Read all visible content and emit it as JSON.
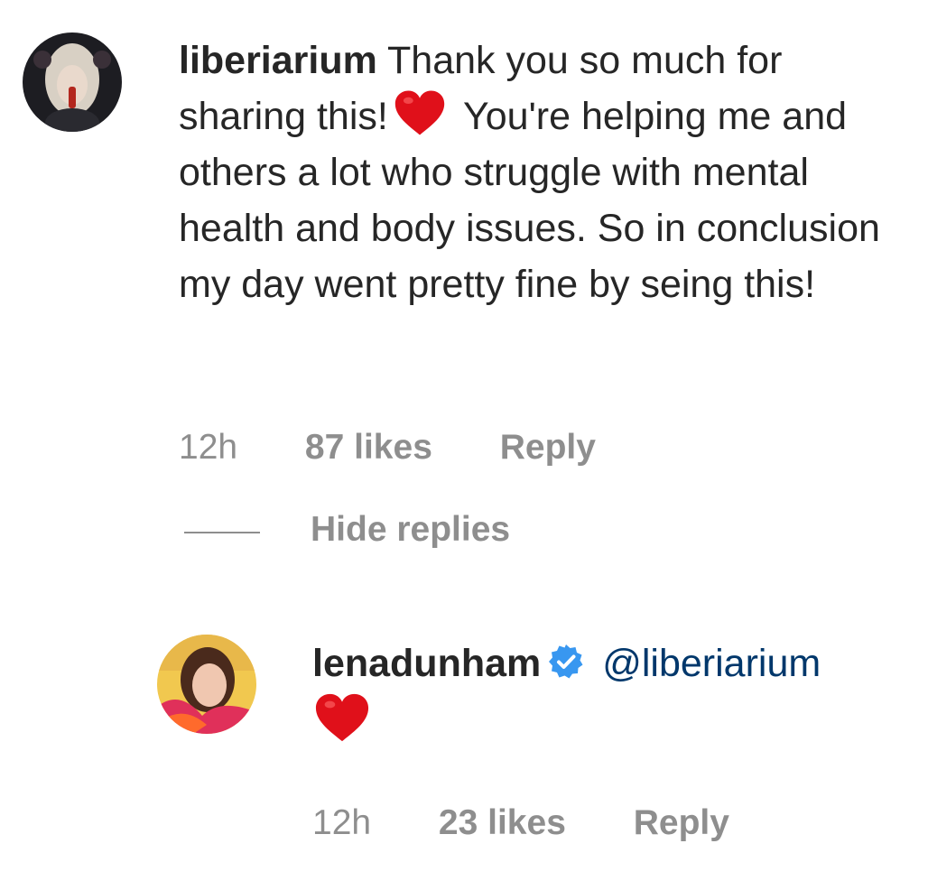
{
  "comment": {
    "username": "liberiarium",
    "text_part1": "Thank you so much for sharing this!",
    "emoji": "heart-icon",
    "text_part2": "You're helping me and others a lot who struggle with mental health and body issues. So in conclusion my day went pretty fine by seing this!",
    "time": "12h",
    "likes": "87 likes",
    "reply_label": "Reply"
  },
  "replies_toggle": {
    "label": "Hide replies"
  },
  "reply": {
    "username": "lenadunham",
    "verified": true,
    "mention": "@liberiarium",
    "emoji": "heart-icon",
    "time": "12h",
    "likes": "23 likes",
    "reply_label": "Reply"
  },
  "colors": {
    "text": "#262626",
    "meta": "#8e8e8e",
    "mention": "#00376b",
    "verified": "#3897f0",
    "heart": "#e0101a"
  }
}
